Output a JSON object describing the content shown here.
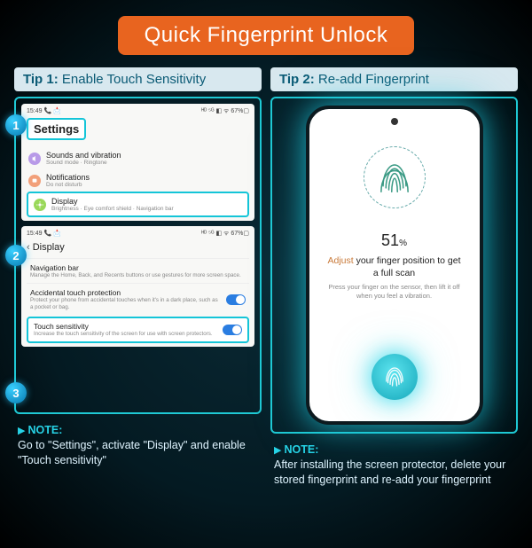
{
  "banner": "Quick Fingerprint Unlock",
  "tip1": {
    "prefix": "Tip 1:",
    "title": "Enable Touch Sensitivity"
  },
  "tip2": {
    "prefix": "Tip 2:",
    "title": "Re-add Fingerprint"
  },
  "bubbles": {
    "b1": "1",
    "b2": "2",
    "b3": "3"
  },
  "status": {
    "time": "15:49",
    "extras": "📞 📩",
    "right": "ᴴᴰ ⁵ᴳ ◧ ᯤ 67%▢"
  },
  "screen1": {
    "settings": "Settings",
    "row_sounds": {
      "title": "Sounds and vibration",
      "sub": "Sound mode · Ringtone"
    },
    "row_notif": {
      "title": "Notifications",
      "sub": "Do not disturb"
    },
    "row_display": {
      "title": "Display",
      "sub": "Brightness · Eye comfort shield · Navigation bar"
    }
  },
  "screen2": {
    "header": "Display",
    "nav": {
      "title": "Navigation bar",
      "sub": "Manage the Home, Back, and Recents buttons or use gestures for more screen space."
    },
    "atp": {
      "title": "Accidental touch protection",
      "sub": "Protect your phone from accidental touches when it's in a dark place, such as a pocket or bag."
    },
    "ts": {
      "title": "Touch sensitivity",
      "sub": "Increase the touch sensitivity of the screen for use with screen protectors."
    }
  },
  "note1": {
    "label": "NOTE:",
    "body": "Go to \"Settings\", activate \"Display\" and enable \"Touch sensitivity\""
  },
  "phone": {
    "percent": "51",
    "percent_unit": "%",
    "adjust_lead": "Adjust",
    "adjust_rest": " your finger position to get a full scan",
    "press": "Press your finger on the sensor, then lift it off when you feel a vibration."
  },
  "note2": {
    "label": "NOTE:",
    "body": "After installing the screen protector, delete your stored fingerprint and re-add your fingerprint"
  }
}
